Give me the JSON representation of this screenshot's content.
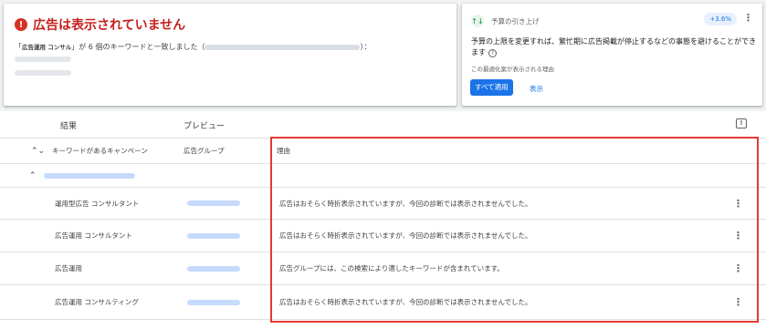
{
  "alert": {
    "icon": "alert-circle-icon",
    "title": "広告は表示されていません",
    "desc_open": "「",
    "desc_keyword": "広告運用 コンサル",
    "desc_rest": "」が 6 個のキーワードと一致しました（",
    "desc_close": "）："
  },
  "recommendation": {
    "icon": "budget-trend-icon",
    "title": "予算の引き上げ",
    "badge": "+3.6%",
    "more": "⋮",
    "body": "予算の上限を変更すれば、繁忙期に広告掲載が停止するなどの事態を避けることができます",
    "help": "?",
    "reason": "この最適化案が表示される理由",
    "apply": "すべて適用",
    "view": "表示"
  },
  "tabs": {
    "results": "結果",
    "preview": "プレビュー",
    "feedback_icon": "!"
  },
  "table": {
    "headers": {
      "campaign": "キーワードがあるキャンペーン",
      "ad_group": "広告グループ",
      "reason": "理由"
    },
    "sort_icon": "⌃",
    "collapse_icon": "⌃",
    "rows": [
      {
        "keyword": "運用型広告 コンサルタント",
        "reason": "広告はおそらく時折表示されていますが、今回の診断では表示されませんでした。"
      },
      {
        "keyword": "広告運用 コンサルタント",
        "reason": "広告はおそらく時折表示されていますが、今回の診断では表示されませんでした。"
      },
      {
        "keyword": "広告運用",
        "reason": "広告グループには、この検索により適したキーワードが含まれています。"
      },
      {
        "keyword": "広告運用 コンサルティング",
        "reason": "広告はおそらく時折表示されていますが、今回の診断では表示されませんでした。"
      }
    ],
    "row_menu": "⋮"
  }
}
